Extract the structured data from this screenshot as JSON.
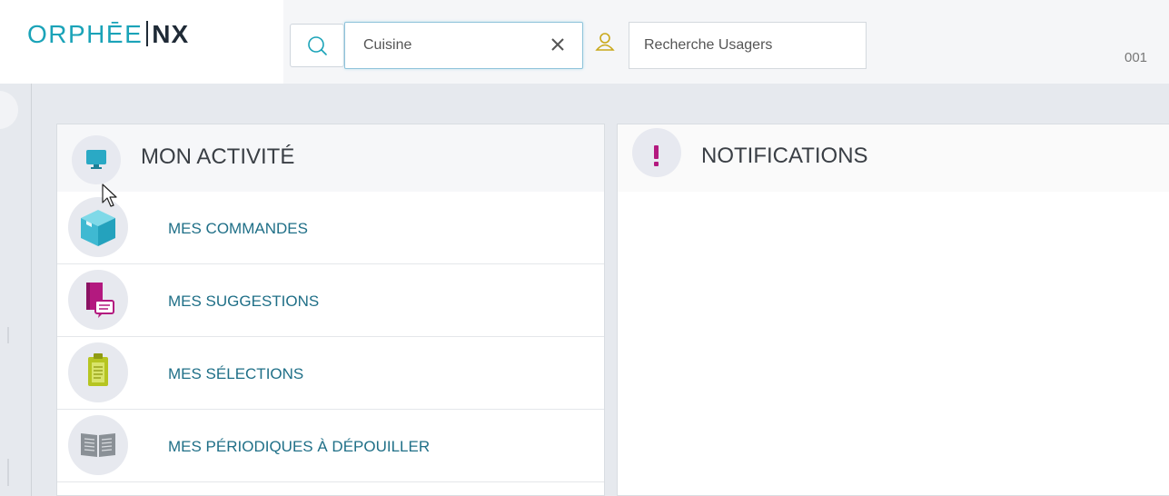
{
  "header": {
    "logo_left": "ORPHĒE",
    "logo_right": "NX",
    "search_value": "Cuisine",
    "users_placeholder": "Recherche Usagers",
    "code": "001"
  },
  "icons": {
    "search": "search-icon",
    "clear": "close-icon",
    "user": "user-icon",
    "monitor": "monitor-icon",
    "alert": "exclamation-icon",
    "box": "box-icon",
    "book_comment": "book-comment-icon",
    "clipboard": "clipboard-icon",
    "open_book": "open-book-icon"
  },
  "colors": {
    "brand": "#1aa3b8",
    "link": "#1f6f87",
    "notif_accent": "#b3197f"
  },
  "activity": {
    "title": "MON ACTIVITÉ",
    "items": [
      {
        "label": "MES COMMANDES"
      },
      {
        "label": "MES SUGGESTIONS"
      },
      {
        "label": "MES SÉLECTIONS"
      },
      {
        "label": "MES PÉRIODIQUES À DÉPOUILLER"
      }
    ]
  },
  "notifications": {
    "title": "NOTIFICATIONS"
  }
}
